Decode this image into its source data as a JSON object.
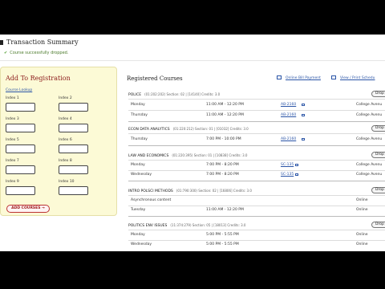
{
  "transaction": {
    "title": "Transaction Summary",
    "message": "Course successfully dropped."
  },
  "add_registration": {
    "title": "Add To Registration",
    "course_lookup": "Course Lookup",
    "index_labels": [
      "Index 1",
      "Index 2",
      "Index 3",
      "Index 4",
      "Index 5",
      "Index 6",
      "Index 7",
      "Index 8",
      "Index 9",
      "Index 10"
    ],
    "add_button": "ADD COURSES →"
  },
  "registered": {
    "title": "Registered Courses",
    "online_bill": "Online Bill Payment",
    "view_print": "View / Print Schedu",
    "drop_label": "Drop",
    "courses": [
      {
        "name": "POLICE",
        "meta": "(01:202:202)  Section: 02  |  [14140]  Credits:  3.0",
        "meetings": [
          {
            "day": "Monday",
            "time": "11:00 AM - 12:20 PM",
            "room": "AB-2160",
            "campus": "College Avenu"
          },
          {
            "day": "Thursday",
            "time": "11:00 AM - 12:20 PM",
            "room": "AB-2160",
            "campus": "College Avenu"
          }
        ]
      },
      {
        "name": "ECON DATA ANALYTICS",
        "meta": "(01:220:212)  Section: 01  |  [01032]  Credits:  3.0",
        "meetings": [
          {
            "day": "Thursday",
            "time": "7:00 PM - 10:00 PM",
            "room": "AB-2160",
            "campus": "College Avenu"
          }
        ]
      },
      {
        "name": "LAW AND ECONOMICS",
        "meta": "(01:220:395)  Section: 01  |  [10838]  Credits:  3.0",
        "meetings": [
          {
            "day": "Monday",
            "time": "7:00 PM - 8:20 PM",
            "room": "SC-135",
            "campus": "College Avenu"
          },
          {
            "day": "Wednesday",
            "time": "7:00 PM - 8:20 PM",
            "room": "SC-135",
            "campus": "College Avenu"
          }
        ]
      },
      {
        "name": "INTRO POLSCI METHODS",
        "meta": "(01:790:300)  Section: 02  |  [16806]  Credits:  3.0",
        "meetings": [
          {
            "day": "Asynchronous content",
            "time": "",
            "room": "",
            "campus": "Online"
          },
          {
            "day": "Tuesday",
            "time": "11:00 AM - 12:20 PM",
            "room": "",
            "campus": "Online"
          }
        ]
      },
      {
        "name": "POLITICS ENV ISSUES",
        "meta": "(11:374:279)  Section: 05  |  [18013]  Credits:  3.0",
        "meetings": [
          {
            "day": "Monday",
            "time": "5:00 PM - 5:55 PM",
            "room": "",
            "campus": "Online"
          },
          {
            "day": "Wednesday",
            "time": "5:00 PM - 5:55 PM",
            "room": "",
            "campus": "Online"
          }
        ]
      }
    ]
  }
}
